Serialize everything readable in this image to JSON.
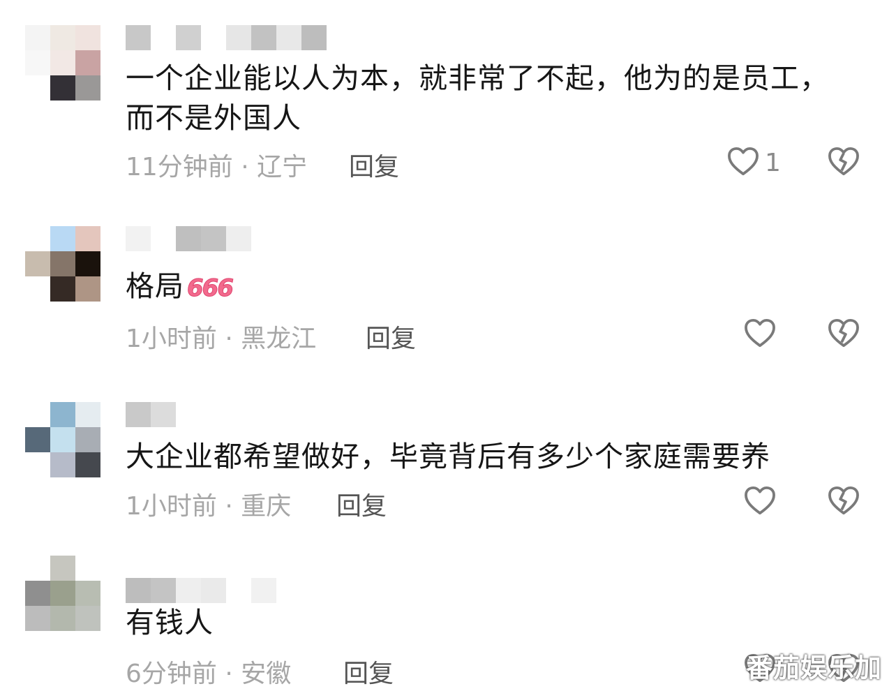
{
  "comments": [
    {
      "text": "一个企业能以人为本，就非常了不起，他为的是员工，而不是外国人",
      "time": "11分钟前",
      "location": "辽宁",
      "reply_label": "回复",
      "like_count": "1",
      "avatar_colors": [
        "#f4f4f4",
        "#efe9e3",
        "#f0e3df",
        "#f7f7f7",
        "#f2e8e5",
        "#c9a3a3",
        "#ffffff",
        "#333036",
        "#9a9897"
      ],
      "name_colors": [
        "#c8c8c8",
        "#ffffff",
        "#d0d0d0",
        "#ffffff",
        "#e6e6e6",
        "#c2c2c2",
        "#e8e8e8",
        "#bdbdbd"
      ]
    },
    {
      "text": "格局",
      "emoji": "666",
      "time": "1小时前",
      "location": "黑龙江",
      "reply_label": "回复",
      "like_count": "",
      "avatar_colors": [
        "#ffffff",
        "#b9d9f4",
        "#e4c6bd",
        "#c8bcae",
        "#857569",
        "#1a120c",
        "#ffffff",
        "#352a25",
        "#ae9585"
      ],
      "name_colors": [
        "#f2f2f2",
        "#ffffff",
        "#bfbfbf",
        "#c4c4c4",
        "#eeeeee"
      ]
    },
    {
      "text": "大企业都希望做好，毕竟背后有多少个家庭需要养",
      "time": "1小时前",
      "location": "重庆",
      "reply_label": "回复",
      "like_count": "",
      "avatar_colors": [
        "#ffffff",
        "#8db5cf",
        "#e5ecf0",
        "#576979",
        "#c4e0ee",
        "#a8adb4",
        "#ffffff",
        "#b6bbc9",
        "#45484e"
      ],
      "name_colors": [
        "#c9c9c9",
        "#dcdcdc"
      ]
    },
    {
      "text": "有钱人",
      "time": "6分钟前",
      "location": "安徽",
      "reply_label": "回复",
      "like_count": "",
      "avatar_colors": [
        "#ffffff",
        "#c6c6bf",
        "#ffffff",
        "#8f8f8f",
        "#9aa08d",
        "#b8bdb2",
        "#bcbcbc",
        "#b3b8ad",
        "#bfc2bd"
      ],
      "name_colors": [
        "#bdbdbd",
        "#c4c4c4",
        "#eeeeee",
        "#eaeaea",
        "#ffffff",
        "#f1f1f1"
      ]
    }
  ],
  "watermark": "番茄娱乐加",
  "icons": {
    "like": "heart-outline-icon",
    "dislike": "broken-heart-icon"
  }
}
